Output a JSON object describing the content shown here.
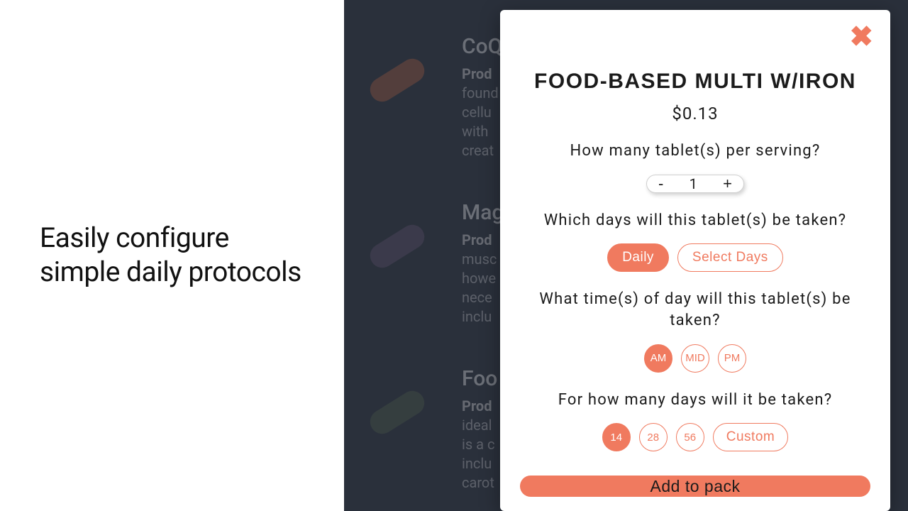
{
  "left": {
    "headline": "Easily configure simple daily protocols"
  },
  "background": {
    "items": [
      {
        "title": "CoQ",
        "snippet_lead": "Prod",
        "snippet_lines": [
          "found",
          "cellu",
          "with",
          "creat"
        ],
        "pill_color": "#a96a52"
      },
      {
        "title": "Mag",
        "snippet_lead": "Prod",
        "snippet_lines": [
          "musc",
          "howe",
          "nece",
          "inclu"
        ],
        "pill_color": "#6b5f7a"
      },
      {
        "title": "Foo",
        "snippet_lead": "Prod",
        "snippet_lines": [
          "ideal",
          "is a c",
          "inclu",
          "carot"
        ],
        "pill_color": "#5b6a5a"
      }
    ]
  },
  "modal": {
    "title": "FOOD-BASED MULTI W/IRON",
    "price": "$0.13",
    "q_serving": "How many tablet(s) per serving?",
    "stepper": {
      "minus": "-",
      "value": "1",
      "plus": "+"
    },
    "q_days_which": "Which days will this tablet(s) be taken?",
    "freq_options": [
      {
        "label": "Daily",
        "active": true
      },
      {
        "label": "Select Days",
        "active": false
      }
    ],
    "q_time": "What time(s) of day will this tablet(s) be taken?",
    "time_options": [
      {
        "label": "AM",
        "active": true
      },
      {
        "label": "MID",
        "active": false
      },
      {
        "label": "PM",
        "active": false
      }
    ],
    "q_duration": "For how many days will it be taken?",
    "duration_options": [
      {
        "label": "14",
        "active": true,
        "round": true
      },
      {
        "label": "28",
        "active": false,
        "round": true
      },
      {
        "label": "56",
        "active": false,
        "round": true
      },
      {
        "label": "Custom",
        "active": false,
        "round": false
      }
    ],
    "add_label": "Add to pack"
  }
}
